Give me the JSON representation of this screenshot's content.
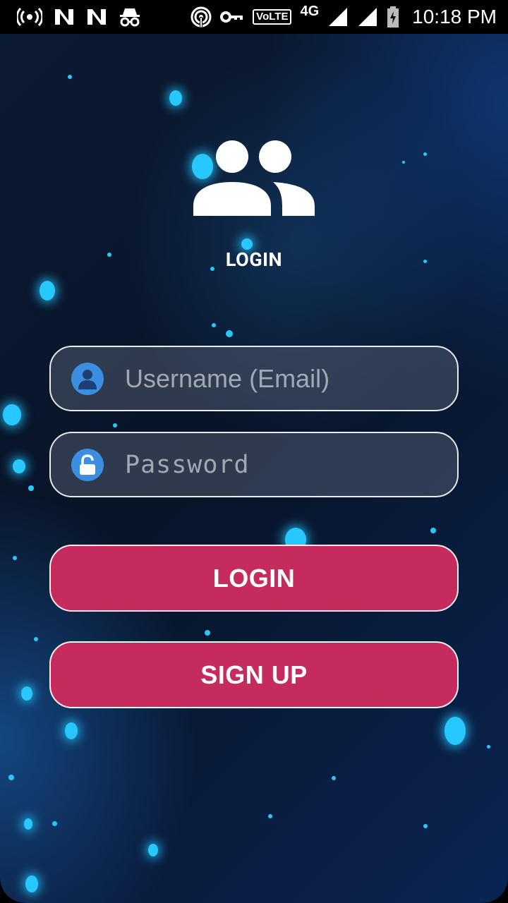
{
  "status_bar": {
    "volte": "VoLTE",
    "network_type": "4G",
    "time": "10:18 PM",
    "icons": [
      "hotspot-icon",
      "n-icon",
      "n-icon",
      "incognito-icon",
      "wifi-hotspot-icon",
      "vpn-key-icon",
      "volte-icon",
      "signal-icon",
      "signal-icon",
      "battery-charging-icon"
    ]
  },
  "header": {
    "title": "LOGIN",
    "logo_icon": "group-users-icon"
  },
  "form": {
    "username": {
      "placeholder": "Username (Email)",
      "value": "",
      "icon": "user-icon"
    },
    "password": {
      "placeholder": "Password",
      "value": "",
      "icon": "unlock-icon"
    },
    "login_label": "LOGIN",
    "signup_label": "SIGN UP"
  },
  "colors": {
    "accent": "#c52b5c",
    "field_icon": "#3b8ee0",
    "particle": "#27c8ff"
  }
}
